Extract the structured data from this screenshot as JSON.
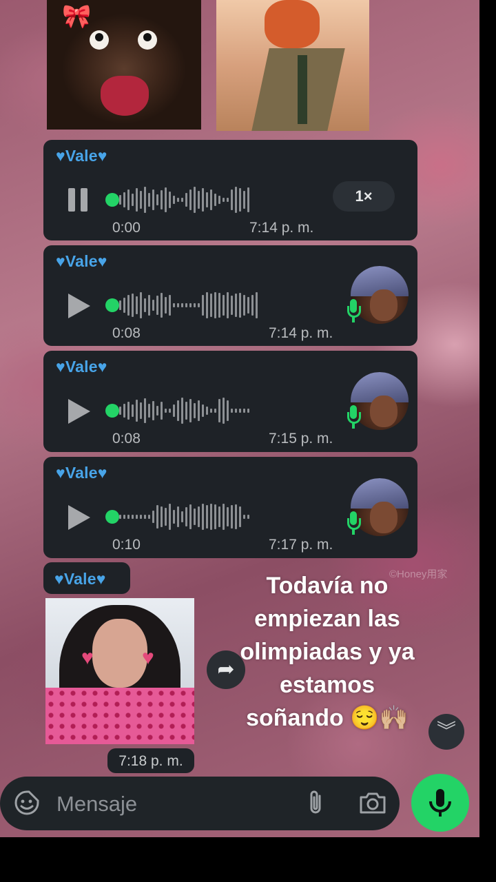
{
  "stickers": [
    {
      "name": "monkey-sticker"
    },
    {
      "name": "fox-sticker"
    }
  ],
  "messages": [
    {
      "sender": "♥Vale♥",
      "duration": "0:00",
      "time": "7:14 p. m.",
      "state": "playing",
      "speed": "1×",
      "played": 0.0
    },
    {
      "sender": "♥Vale♥",
      "duration": "0:08",
      "time": "7:14 p. m.",
      "state": "paused",
      "played": 0.0
    },
    {
      "sender": "♥Vale♥",
      "duration": "0:08",
      "time": "7:15 p. m.",
      "state": "paused",
      "played": 0.0
    },
    {
      "sender": "♥Vale♥",
      "duration": "0:10",
      "time": "7:17 p. m.",
      "state": "paused",
      "played": 0.0
    }
  ],
  "image_message": {
    "sender": "♥Vale♥",
    "time": "7:18 p. m."
  },
  "overlay_caption": "Todavía no empiezan las olimpiadas y ya estamos soñando 😌🙌🏼",
  "watermark": "©Honey用家",
  "composer": {
    "placeholder": "Mensaje"
  },
  "colors": {
    "accent_green": "#23d366",
    "bubble": "#1e2227",
    "sender_blue": "#48a4e8"
  },
  "icons": {
    "emoji": "sticker-icon",
    "attach": "paperclip-icon",
    "camera": "camera-icon",
    "mic": "microphone-icon",
    "forward": "forward-icon",
    "scroll": "double-chevron-down-icon"
  }
}
